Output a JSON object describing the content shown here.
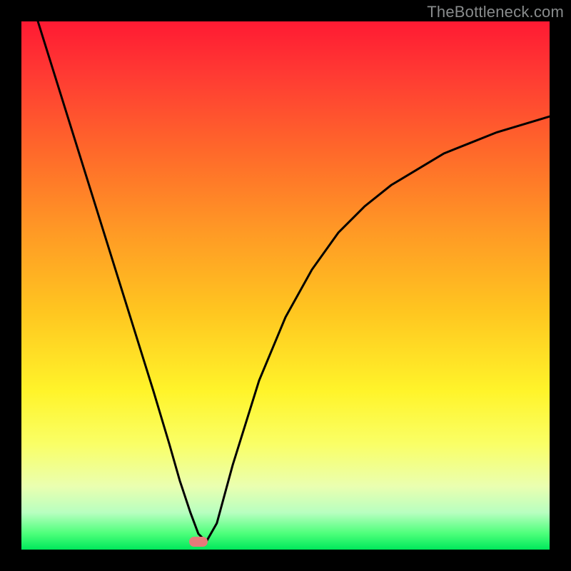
{
  "watermark": "TheBottleneck.com",
  "chart_data": {
    "type": "line",
    "title": "",
    "xlabel": "",
    "ylabel": "",
    "xlim": [
      0,
      100
    ],
    "ylim": [
      0,
      100
    ],
    "series": [
      {
        "name": "bottleneck-curve",
        "x": [
          0,
          5,
          10,
          15,
          20,
          25,
          28,
          30,
          32,
          33.5,
          35,
          37,
          40,
          45,
          50,
          55,
          60,
          65,
          70,
          75,
          80,
          85,
          90,
          95,
          100
        ],
        "y": [
          110,
          94,
          78,
          62,
          46,
          30,
          20,
          13,
          7,
          3,
          1.5,
          5,
          16,
          32,
          44,
          53,
          60,
          65,
          69,
          72,
          75,
          77,
          79,
          80.5,
          82
        ]
      }
    ],
    "marker": {
      "x": 33.5,
      "y": 1.5
    },
    "note": "x and y read in percent of plot width/height; y=0 at bottom, y=100 at top. Values estimated from pixels."
  }
}
